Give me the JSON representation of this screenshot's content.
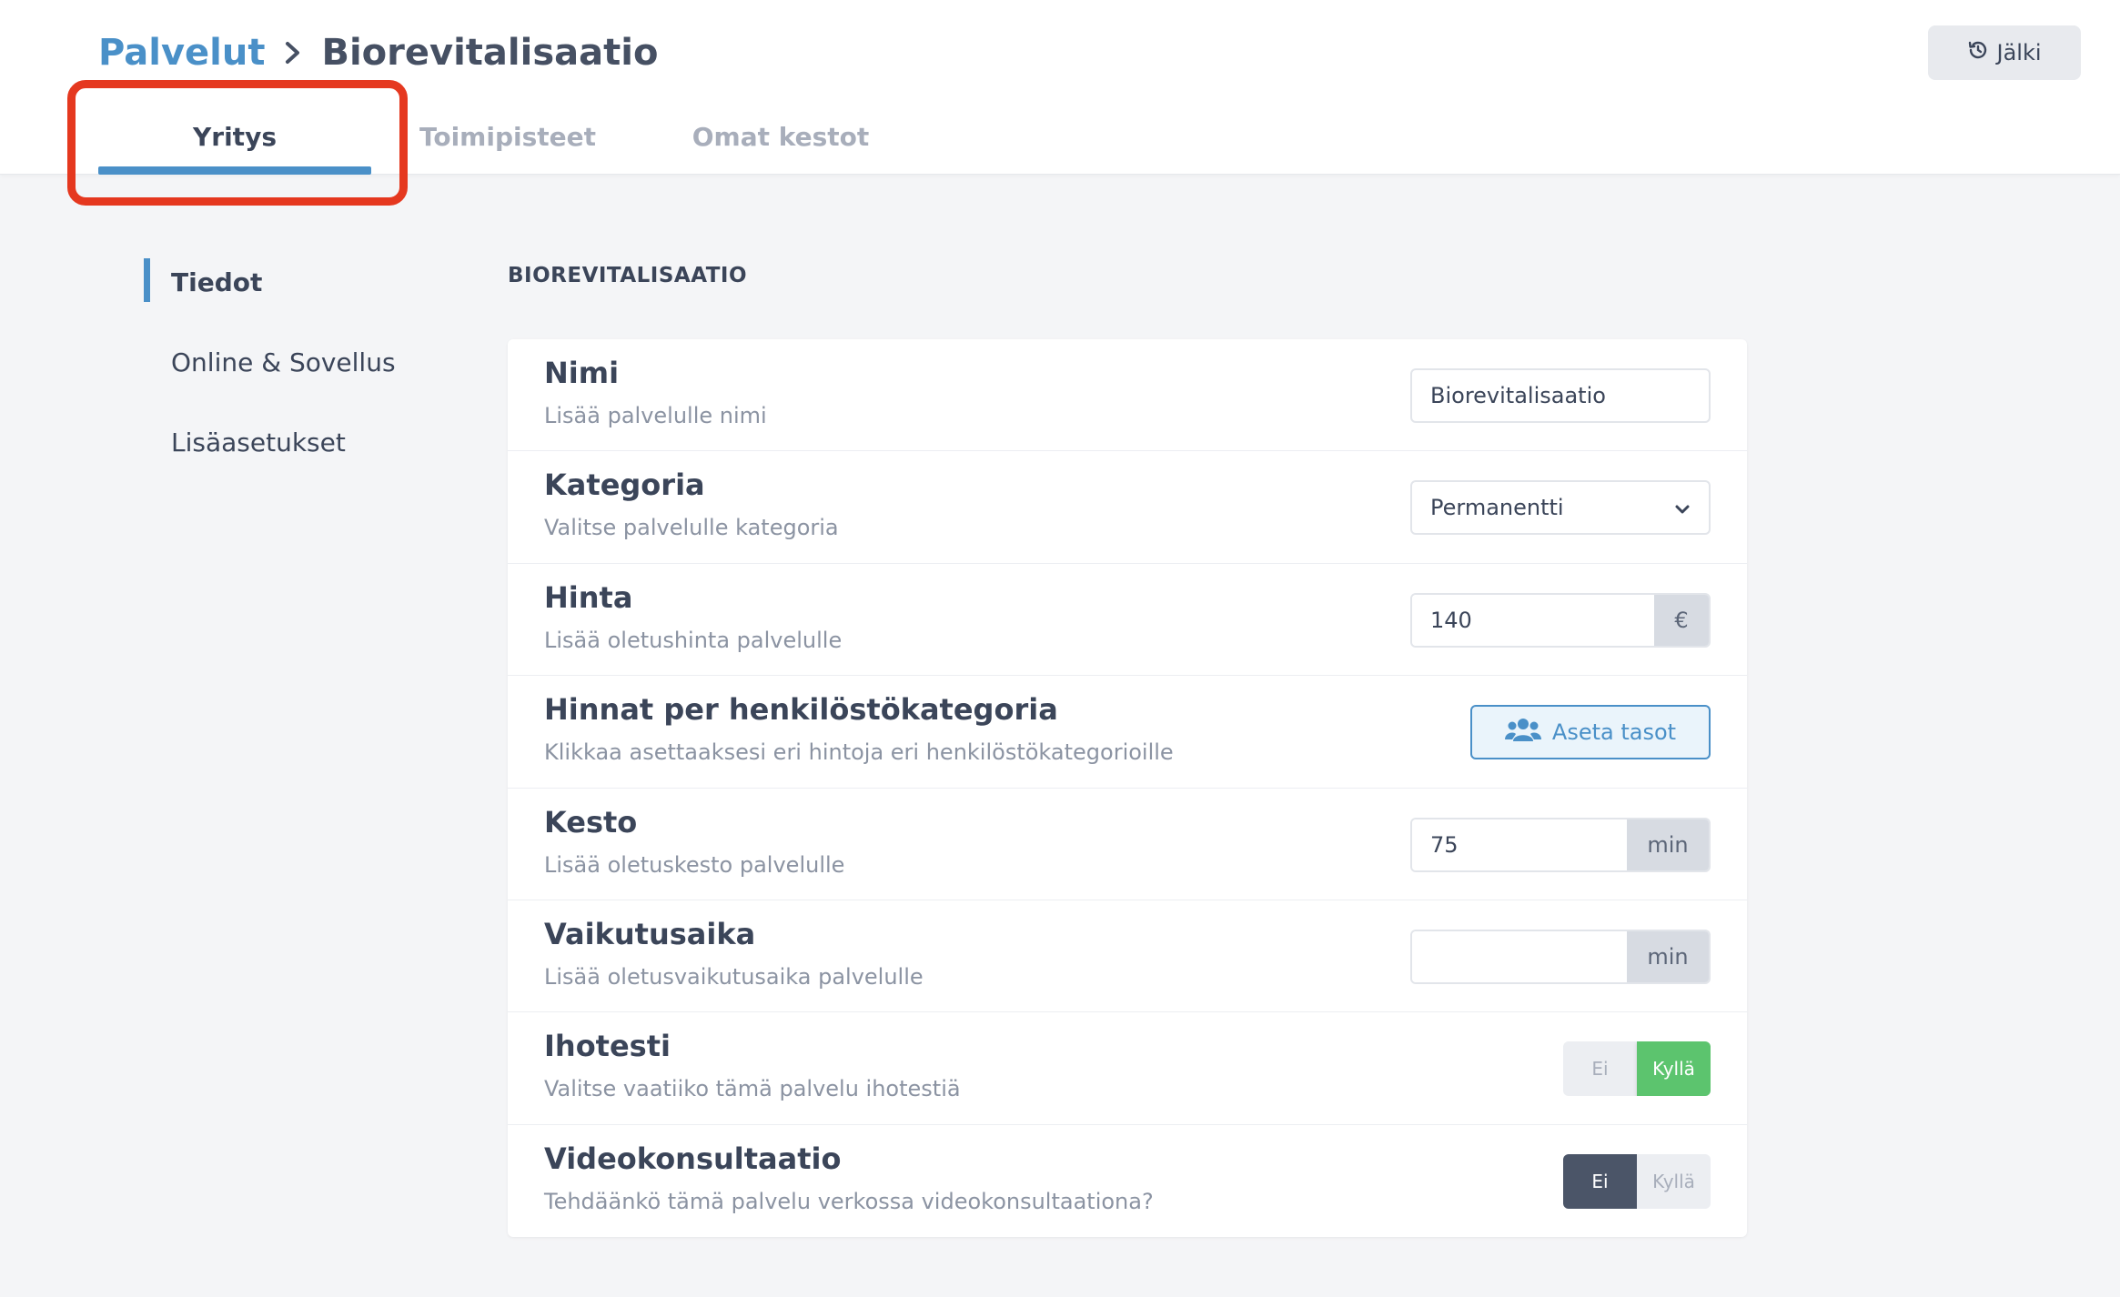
{
  "breadcrumb": {
    "parent": "Palvelut",
    "current": "Biorevitalisaatio"
  },
  "tabs": [
    {
      "label": "Yritys",
      "active": true
    },
    {
      "label": "Toimipisteet",
      "active": false
    },
    {
      "label": "Omat kestot",
      "active": false
    }
  ],
  "history_button": {
    "label": "Jälki",
    "icon": "history-icon"
  },
  "sidenav": {
    "items": [
      {
        "label": "Tiedot",
        "active": true
      },
      {
        "label": "Online & Sovellus",
        "active": false
      },
      {
        "label": "Lisäasetukset",
        "active": false
      }
    ]
  },
  "section_title": "BIOREVITALISAATIO",
  "rows": {
    "name": {
      "title": "Nimi",
      "desc": "Lisää palvelulle nimi",
      "value": "Biorevitalisaatio"
    },
    "category": {
      "title": "Kategoria",
      "desc": "Valitse palvelulle kategoria",
      "value": "Permanentti"
    },
    "price": {
      "title": "Hinta",
      "desc": "Lisää oletushinta palvelulle",
      "value": "140",
      "unit": "€"
    },
    "staff_prices": {
      "title": "Hinnat per henkilöstökategoria",
      "desc": "Klikkaa asettaaksesi eri hintoja eri henkilöstökategorioille",
      "button": "Aseta tasot",
      "icon": "users-icon"
    },
    "duration": {
      "title": "Kesto",
      "desc": "Lisää oletuskesto palvelulle",
      "value": "75",
      "unit": "min"
    },
    "effect_time": {
      "title": "Vaikutusaika",
      "desc": "Lisää oletusvaikutusaika palvelulle",
      "value": "",
      "unit": "min"
    },
    "skin_test": {
      "title": "Ihotesti",
      "desc": "Valitse vaatiiko tämä palvelu ihotestiä",
      "no": "Ei",
      "yes": "Kyllä",
      "selected": "yes"
    },
    "video": {
      "title": "Videokonsultaatio",
      "desc": "Tehdäänkö tämä palvelu verkossa videokonsultaationa?",
      "no": "Ei",
      "yes": "Kyllä",
      "selected": "no"
    }
  },
  "colors": {
    "accent": "#4a90c8",
    "highlight": "#e5381f",
    "toggle_yes": "#5cc46e",
    "toggle_no": "#4b5568"
  }
}
